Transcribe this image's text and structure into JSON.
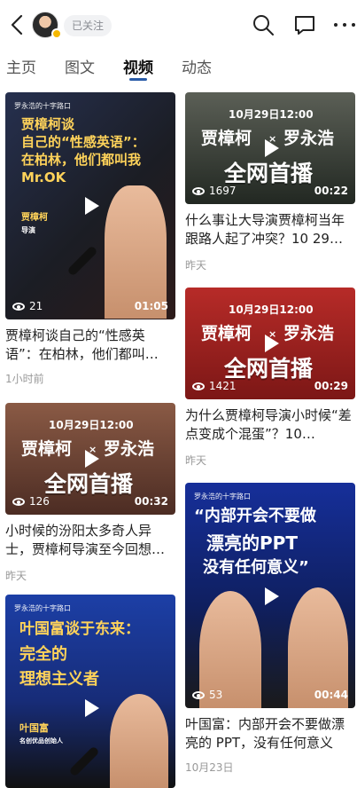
{
  "header": {
    "follow_label": "已关注"
  },
  "tabs": [
    {
      "label": "主页"
    },
    {
      "label": "图文"
    },
    {
      "label": "视频"
    },
    {
      "label": "动态"
    }
  ],
  "cards": [
    {
      "title": "贾樟柯谈自己的“性感英语”：在柏林，他们都叫…",
      "time": "1小时前",
      "views": "21",
      "duration": "01:05",
      "thumb_brand": "罗永浩的十字路口",
      "thumb_line1": "贾樟柯谈",
      "thumb_line2": "自己的“性感英语”：",
      "thumb_line3": "在柏林，他们都叫我",
      "thumb_line4": "Mr.OK",
      "thumb_name": "贾樟柯",
      "thumb_role": "导演"
    },
    {
      "title": "什么事让大导演贾樟柯当年跟路人起了冲突？10 29…",
      "time": "昨天",
      "views": "1697",
      "duration": "00:22",
      "thumb_date": "10月29日12:00",
      "thumb_left": "贾樟柯",
      "thumb_x": "×",
      "thumb_right": "罗永浩",
      "thumb_banner": "全网首播"
    },
    {
      "title": "为什么贾樟柯导演小时候“差点变成个混蛋”？10…",
      "time": "昨天",
      "views": "1421",
      "duration": "00:29",
      "thumb_date": "10月29日12:00",
      "thumb_left": "贾樟柯",
      "thumb_x": "×",
      "thumb_right": "罗永浩",
      "thumb_banner": "全网首播"
    },
    {
      "title": "小时候的汾阳太多奇人异士，贾樟柯导演至今回想…",
      "time": "昨天",
      "views": "126",
      "duration": "00:32",
      "thumb_date": "10月29日12:00",
      "thumb_left": "贾樟柯",
      "thumb_x": "×",
      "thumb_right": "罗永浩",
      "thumb_banner": "全网首播"
    },
    {
      "title": "叶国富：内部开会不要做漂亮的 PPT，没有任何意义",
      "time": "10月23日",
      "views": "53",
      "duration": "00:44",
      "thumb_brand": "罗永浩的十字路口",
      "thumb_line1": "“内部开会不要做",
      "thumb_line2": "漂亮的PPT",
      "thumb_line3": "没有任何意义”"
    },
    {
      "thumb_brand": "罗永浩的十字路口",
      "thumb_line1": "叶国富谈于东来：",
      "thumb_line2": "完全的",
      "thumb_line3": "理想主义者",
      "thumb_name": "叶国富",
      "thumb_role": "名创优品创始人"
    }
  ],
  "icons": {
    "back": "back-chevron-icon",
    "search": "search-icon",
    "chat": "message-icon",
    "more": "more-icon",
    "eye": "eye-icon",
    "play": "play-icon"
  }
}
